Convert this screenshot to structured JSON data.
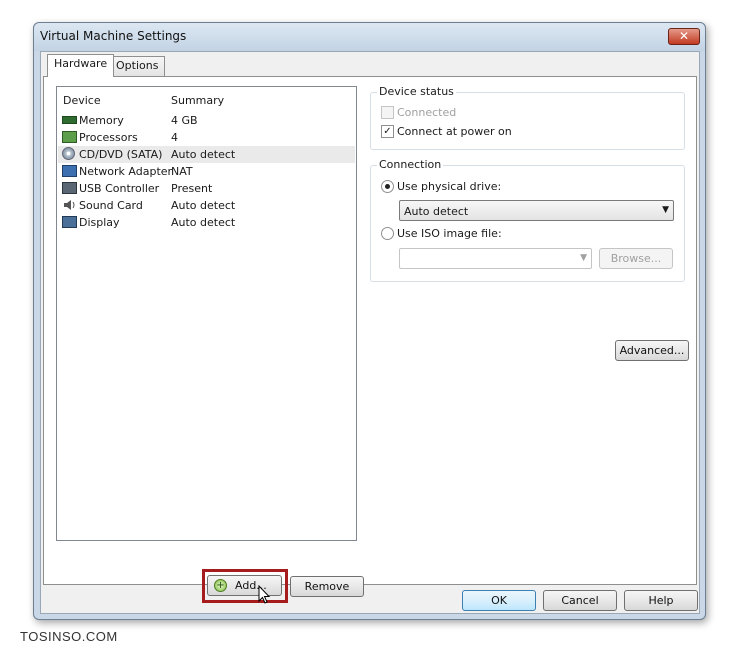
{
  "window": {
    "title": "Virtual Machine Settings",
    "close_glyph": "✕"
  },
  "tabs": [
    {
      "label": "Hardware",
      "active": true
    },
    {
      "label": "Options",
      "active": false
    }
  ],
  "device_list": {
    "columns": [
      "Device",
      "Summary"
    ],
    "rows": [
      {
        "icon": "memory-icon",
        "name": "Memory",
        "summary": "4 GB"
      },
      {
        "icon": "processor-icon",
        "name": "Processors",
        "summary": "4"
      },
      {
        "icon": "cd-dvd-icon",
        "name": "CD/DVD (SATA)",
        "summary": "Auto detect",
        "selected": true
      },
      {
        "icon": "network-adapter-icon",
        "name": "Network Adapter",
        "summary": "NAT"
      },
      {
        "icon": "usb-icon",
        "name": "USB Controller",
        "summary": "Present"
      },
      {
        "icon": "sound-card-icon",
        "name": "Sound Card",
        "summary": "Auto detect"
      },
      {
        "icon": "display-icon",
        "name": "Display",
        "summary": "Auto detect"
      }
    ]
  },
  "device_status": {
    "title": "Device status",
    "connected_label": "Connected",
    "connected_checked": false,
    "connect_power_label": "Connect at power on",
    "connect_power_checked": true,
    "check_glyph": "✓"
  },
  "connection": {
    "title": "Connection",
    "physical_label": "Use physical drive:",
    "physical_selected": true,
    "physical_value": "Auto detect",
    "iso_label": "Use ISO image file:",
    "iso_selected": false,
    "iso_value": "",
    "browse_label": "Browse...",
    "arrow_glyph": "▼"
  },
  "buttons": {
    "advanced": "Advanced...",
    "add": "Add...",
    "remove": "Remove",
    "ok": "OK",
    "cancel": "Cancel",
    "help": "Help"
  },
  "watermark": "TOSINSO.COM",
  "colors": {
    "highlight": "#a61c1c",
    "selected_row": "#eaeaea",
    "close_button": "#c23a22"
  }
}
